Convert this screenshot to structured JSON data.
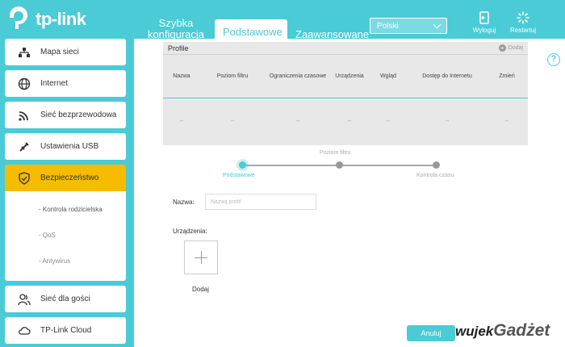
{
  "brand": {
    "name": "tp-link"
  },
  "topnav": {
    "tabs": [
      {
        "label": "Szybka konfiguracja"
      },
      {
        "label": "Podstawowe"
      },
      {
        "label": "Zaawansowane"
      }
    ],
    "language": "Polski",
    "logout_label": "Wyloguj",
    "restart_label": "Restartuj"
  },
  "sidebar": {
    "items": [
      {
        "label": "Mapa sieci",
        "icon": "network-map-icon"
      },
      {
        "label": "Internet",
        "icon": "globe-icon"
      },
      {
        "label": "Sieć bezprzewodowa",
        "icon": "wifi-icon"
      },
      {
        "label": "Ustawienia USB",
        "icon": "usb-icon"
      },
      {
        "label": "Bezpieczeństwo",
        "icon": "shield-icon"
      },
      {
        "label": "Sieć dla gości",
        "icon": "guests-icon"
      },
      {
        "label": "TP-Link Cloud",
        "icon": "cloud-icon"
      }
    ],
    "submenu": [
      {
        "label": "- Kontrola rodzicielska"
      },
      {
        "label": "- QoS"
      },
      {
        "label": "- Antywirus"
      }
    ]
  },
  "profile": {
    "title": "Profile",
    "add_label": "Dodaj",
    "columns": [
      "Nazwa",
      "Poziom filtru",
      "Ograniczenia czasowe",
      "Urządzenia",
      "Wgląd",
      "Dostęp do Internetu",
      "Zmień"
    ],
    "row": [
      "--",
      "--",
      "--",
      "--",
      "--",
      "--",
      "--"
    ]
  },
  "stepper": {
    "steps": [
      "Podstawowe",
      "Poziom filtru",
      "Kontrola czasu"
    ],
    "current": 0
  },
  "form": {
    "name_label": "Nazwa:",
    "name_placeholder": "Nazwij profil",
    "devices_label": "Urządzenia:",
    "add_device_label": "Dodaj"
  },
  "actions": {
    "cancel_label": "Anuluj"
  },
  "watermark": {
    "text_a": "wujek",
    "text_b": "Gadżet"
  },
  "colors": {
    "accent": "#4acbd6",
    "active": "#f6bc00"
  }
}
